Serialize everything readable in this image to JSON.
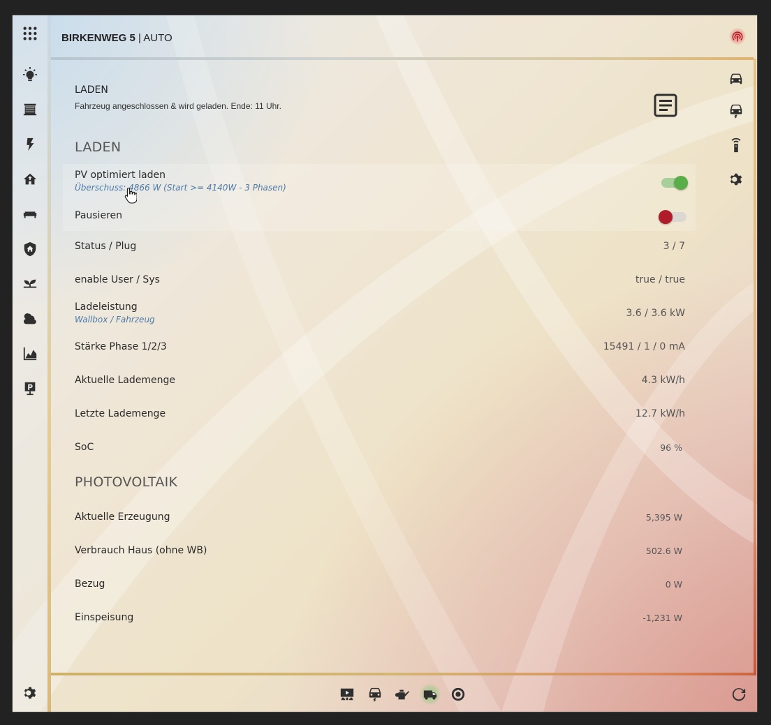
{
  "header": {
    "title_bold": "BIRKENWEG 5",
    "title_sep": " | ",
    "title_rest": "AUTO"
  },
  "sidebar": {
    "items": [
      {
        "icon": "apps-grid-icon"
      },
      {
        "icon": "lightbulb-icon"
      },
      {
        "icon": "blinds-icon"
      },
      {
        "icon": "flash-icon"
      },
      {
        "icon": "home-up-icon"
      },
      {
        "icon": "sofa-icon"
      },
      {
        "icon": "shield-home-icon"
      },
      {
        "icon": "sprout-icon"
      },
      {
        "icon": "weather-cloudy-icon"
      },
      {
        "icon": "chart-area-icon"
      },
      {
        "icon": "parking-icon"
      }
    ],
    "settings_icon": "gear-icon"
  },
  "right_nav": [
    "car-icon",
    "car-electric-icon",
    "remote-icon",
    "gear-icon"
  ],
  "card": {
    "title": "LADEN",
    "subtitle": "Fahrzeug angeschlossen & wird geladen. Ende: 11 Uhr."
  },
  "sections": {
    "laden": "LADEN",
    "pv": "PHOTOVOLTAIK"
  },
  "rows": {
    "pv_opt": {
      "label": "PV optimiert laden",
      "sub": "Überschuss: 4866 W (Start >= 4140W - 3 Phasen)",
      "state": true
    },
    "pause": {
      "label": "Pausieren",
      "state": false
    },
    "status": {
      "label": "Status / Plug",
      "value": "3 / 7"
    },
    "enable": {
      "label": "enable User / Sys",
      "value": "true / true"
    },
    "ladeleistung": {
      "label": "Ladeleistung",
      "sub": "Wallbox / Fahrzeug",
      "value": "3.6 / 3.6 kW"
    },
    "staerke": {
      "label": "Stärke Phase 1/2/3",
      "value": "15491 / 1 / 0 mA"
    },
    "aktuelle": {
      "label": "Aktuelle Lademenge",
      "value": "4.3 kW/h"
    },
    "letzte": {
      "label": "Letzte Lademenge",
      "value": "12.7 kW/h"
    },
    "soc": {
      "label": "SoC",
      "value": "96 %"
    },
    "erzeugung": {
      "label": "Aktuelle Erzeugung",
      "value": "5,395 W"
    },
    "verbrauch": {
      "label": "Verbrauch Haus (ohne WB)",
      "value": "502.6 W"
    },
    "bezug": {
      "label": "Bezug",
      "value": "0 W"
    },
    "einspeisung": {
      "label": "Einspeisung",
      "value": "-1,231 W"
    }
  },
  "footer": {
    "items": [
      "projector-icon",
      "car-electric-icon",
      "watering-can-icon",
      "van-icon",
      "robot-vacuum-icon"
    ],
    "active": "van-icon",
    "refresh_icon": "refresh-icon"
  },
  "colors": {
    "toggle_on": "#5aae4a",
    "toggle_off": "#b01c2a",
    "subtext": "#4f7aa5"
  }
}
